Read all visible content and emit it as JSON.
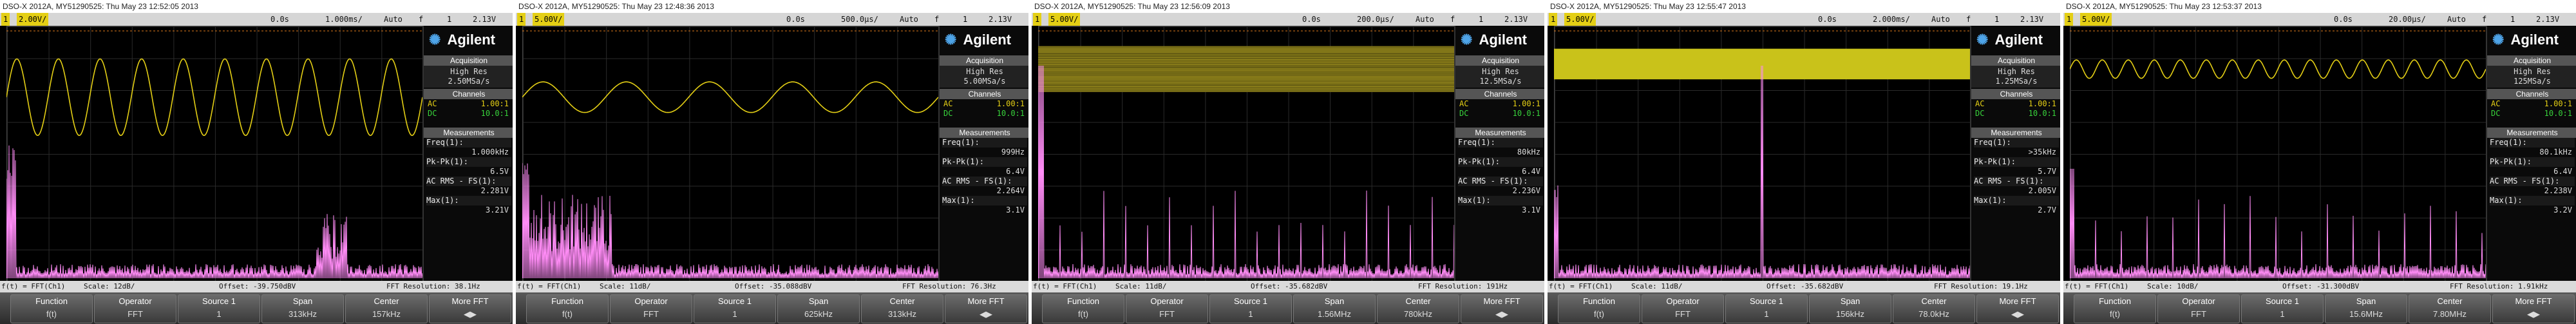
{
  "colors": {
    "ch1": "#e4cf15",
    "fft": "#ff8cf6",
    "accent": "#4ea4e8"
  },
  "scopes": [
    {
      "header": "DSO-X 2012A, MY51290525: Thu May 23 12:52:05 2013",
      "status": {
        "ch1": "1",
        "ch1_scale": "2.00V/",
        "ch2": "2",
        "tpos": "0.0s",
        "tdiv": "1.000ms/",
        "mode": "Auto",
        "rhs": "f",
        "trig": "1",
        "trigv": "2.13V"
      },
      "brand": "Agilent",
      "acquisition": {
        "title": "Acquisition",
        "mode": "High Res",
        "rate": "2.50MSa/s"
      },
      "channels": {
        "title": "Channels",
        "ac_label": "AC",
        "ac_val": "1.00:1",
        "dc_label": "DC",
        "dc_val": "10.0:1"
      },
      "measurements": {
        "title": "Measurements",
        "items": [
          {
            "label": "Freq(1):",
            "value": "1.000kHz"
          },
          {
            "label": "Pk-Pk(1):",
            "value": "6.5V"
          },
          {
            "label": "AC RMS - FS(1):",
            "value": "2.281V"
          },
          {
            "label": "Max(1):",
            "value": "3.21V"
          }
        ]
      },
      "fft_bar": {
        "a": "f(t) = FFT(Ch1)",
        "b": "Scale: 12dB/",
        "c": "Offset: -39.750dBV",
        "d": "FFT Resolution: 38.1Hz"
      },
      "softkeys": [
        {
          "label": "Function",
          "value": "f(t)"
        },
        {
          "label": "Operator",
          "value": "FFT"
        },
        {
          "label": "Source 1",
          "value": "1"
        },
        {
          "label": "Span",
          "value": "313kHz"
        },
        {
          "label": "Center",
          "value": "157kHz"
        },
        {
          "label": "More FFT",
          "value": "◀▶"
        }
      ],
      "trace": {
        "kind": "sine",
        "cycles": 10,
        "amp": 0.75,
        "center": 0.28,
        "fill": false
      },
      "fft": {
        "kind": "low_bumps"
      }
    },
    {
      "header": "DSO-X 2012A, MY51290525: Thu May 23 12:48:36 2013",
      "status": {
        "ch1": "1",
        "ch1_scale": "5.00V/",
        "ch2": "2",
        "tpos": "0.0s",
        "tdiv": "500.0µs/",
        "mode": "Auto",
        "rhs": "f",
        "trig": "1",
        "trigv": "2.13V"
      },
      "brand": "Agilent",
      "acquisition": {
        "title": "Acquisition",
        "mode": "High Res",
        "rate": "5.00MSa/s"
      },
      "channels": {
        "title": "Channels",
        "ac_label": "AC",
        "ac_val": "1.00:1",
        "dc_label": "DC",
        "dc_val": "10.0:1"
      },
      "measurements": {
        "title": "Measurements",
        "items": [
          {
            "label": "Freq(1):",
            "value": "999Hz"
          },
          {
            "label": "Pk-Pk(1):",
            "value": "6.4V"
          },
          {
            "label": "AC RMS - FS(1):",
            "value": "2.264V"
          },
          {
            "label": "Max(1):",
            "value": "3.1V"
          }
        ]
      },
      "fft_bar": {
        "a": "f(t) = FFT(Ch1)",
        "b": "Scale: 11dB/",
        "c": "Offset: -35.088dBV",
        "d": "FFT Resolution: 76.3Hz"
      },
      "softkeys": [
        {
          "label": "Function",
          "value": "f(t)"
        },
        {
          "label": "Operator",
          "value": "FFT"
        },
        {
          "label": "Source 1",
          "value": "1"
        },
        {
          "label": "Span",
          "value": "625kHz"
        },
        {
          "label": "Center",
          "value": "313kHz"
        },
        {
          "label": "More FFT",
          "value": "◀▶"
        }
      ],
      "trace": {
        "kind": "sine",
        "cycles": 5,
        "amp": 0.3,
        "center": 0.28,
        "fill": false
      },
      "fft": {
        "kind": "low_block"
      }
    },
    {
      "header": "DSO-X 2012A, MY51290525: Thu May 23 12:56:09 2013",
      "status": {
        "ch1": "1",
        "ch1_scale": "5.00V/",
        "ch2": "2",
        "tpos": "0.0s",
        "tdiv": "200.0µs/",
        "mode": "Auto",
        "rhs": "f",
        "trig": "1",
        "trigv": "2.13V"
      },
      "brand": "Agilent",
      "acquisition": {
        "title": "Acquisition",
        "mode": "High Res",
        "rate": "12.5MSa/s"
      },
      "channels": {
        "title": "Channels",
        "ac_label": "AC",
        "ac_val": "1.00:1",
        "dc_label": "DC",
        "dc_val": "10.0:1"
      },
      "measurements": {
        "title": "Measurements",
        "items": [
          {
            "label": "Freq(1):",
            "value": "80kHz"
          },
          {
            "label": "Pk-Pk(1):",
            "value": "6.4V"
          },
          {
            "label": "AC RMS - FS(1):",
            "value": "2.236V"
          },
          {
            "label": "Max(1):",
            "value": "3.1V"
          }
        ]
      },
      "fft_bar": {
        "a": "f(t) = FFT(Ch1)",
        "b": "Scale: 11dB/",
        "c": "Offset: -35.682dBV",
        "d": "FFT Resolution: 191Hz"
      },
      "softkeys": [
        {
          "label": "Function",
          "value": "f(t)"
        },
        {
          "label": "Operator",
          "value": "FFT"
        },
        {
          "label": "Source 1",
          "value": "1"
        },
        {
          "label": "Span",
          "value": "1.56MHz"
        },
        {
          "label": "Center",
          "value": "780kHz"
        },
        {
          "label": "More FFT",
          "value": "◀▶"
        }
      ],
      "trace": {
        "kind": "band",
        "top": 0.08,
        "height": 0.18,
        "dense": false
      },
      "fft": {
        "kind": "spikes_left"
      }
    },
    {
      "header": "DSO-X 2012A, MY51290525: Thu May 23 12:55:47 2013",
      "status": {
        "ch1": "1",
        "ch1_scale": "5.00V/",
        "ch2": "2",
        "tpos": "0.0s",
        "tdiv": "2.000ms/",
        "mode": "Auto",
        "rhs": "f",
        "trig": "1",
        "trigv": "2.13V"
      },
      "brand": "Agilent",
      "acquisition": {
        "title": "Acquisition",
        "mode": "High Res",
        "rate": "1.25MSa/s"
      },
      "channels": {
        "title": "Channels",
        "ac_label": "AC",
        "ac_val": "1.00:1",
        "dc_label": "DC",
        "dc_val": "10.0:1"
      },
      "measurements": {
        "title": "Measurements",
        "items": [
          {
            "label": "Freq(1):",
            "value": ">35kHz"
          },
          {
            "label": "Pk-Pk(1):",
            "value": "5.7V"
          },
          {
            "label": "AC RMS - FS(1):",
            "value": "2.005V"
          },
          {
            "label": "Max(1):",
            "value": "2.7V"
          }
        ]
      },
      "fft_bar": {
        "a": "f(t) = FFT(Ch1)",
        "b": "Scale: 11dB/",
        "c": "Offset: -35.682dBV",
        "d": "FFT Resolution: 19.1Hz"
      },
      "softkeys": [
        {
          "label": "Function",
          "value": "f(t)"
        },
        {
          "label": "Operator",
          "value": "FFT"
        },
        {
          "label": "Source 1",
          "value": "1"
        },
        {
          "label": "Span",
          "value": "156kHz"
        },
        {
          "label": "Center",
          "value": "78.0kHz"
        },
        {
          "label": "More FFT",
          "value": "◀▶"
        }
      ],
      "trace": {
        "kind": "band",
        "top": 0.09,
        "height": 0.12,
        "dense": true
      },
      "fft": {
        "kind": "single_spike"
      }
    },
    {
      "header": "DSO-X 2012A, MY51290525: Thu May 23 12:53:37 2013",
      "status": {
        "ch1": "1",
        "ch1_scale": "5.00V/",
        "ch2": "2",
        "tpos": "0.0s",
        "tdiv": "20.00µs/",
        "mode": "Auto",
        "rhs": "f",
        "trig": "1",
        "trigv": "2.13V"
      },
      "brand": "Agilent",
      "acquisition": {
        "title": "Acquisition",
        "mode": "High Res",
        "rate": "125MSa/s"
      },
      "channels": {
        "title": "Channels",
        "ac_label": "AC",
        "ac_val": "1.00:1",
        "dc_label": "DC",
        "dc_val": "10.0:1"
      },
      "measurements": {
        "title": "Measurements",
        "items": [
          {
            "label": "Freq(1):",
            "value": "80.1kHz"
          },
          {
            "label": "Pk-Pk(1):",
            "value": "6.4V"
          },
          {
            "label": "AC RMS - FS(1):",
            "value": "2.238V"
          },
          {
            "label": "Max(1):",
            "value": "3.2V"
          }
        ]
      },
      "fft_bar": {
        "a": "f(t) = FFT(Ch1)",
        "b": "Scale: 10dB/",
        "c": "Offset: -31.300dBV",
        "d": "FFT Resolution: 1.91kHz"
      },
      "softkeys": [
        {
          "label": "Function",
          "value": "f(t)"
        },
        {
          "label": "Operator",
          "value": "FFT"
        },
        {
          "label": "Source 1",
          "value": "1"
        },
        {
          "label": "Span",
          "value": "15.6MHz"
        },
        {
          "label": "Center",
          "value": "7.80MHz"
        },
        {
          "label": "More FFT",
          "value": "◀▶"
        }
      ],
      "trace": {
        "kind": "sine",
        "cycles": 16,
        "amp": 0.18,
        "center": 0.17,
        "fill": false
      },
      "fft": {
        "kind": "spikes_even"
      }
    }
  ]
}
